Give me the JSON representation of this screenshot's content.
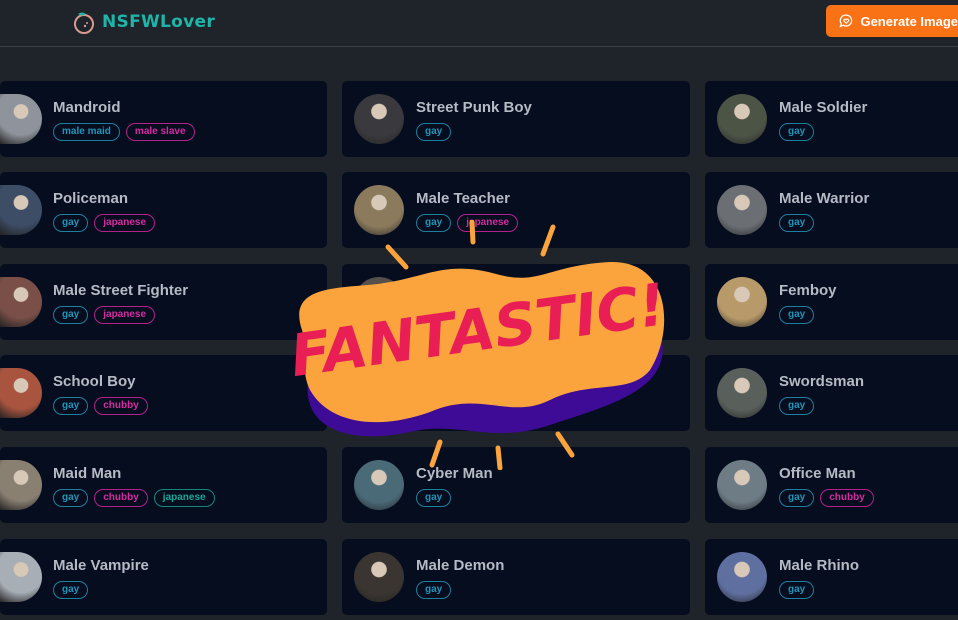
{
  "header": {
    "brand": "NSFWLover",
    "generate_button": "Generate Image"
  },
  "colors": {
    "accent": "#f97316",
    "brand": "#1fb5a8",
    "tag_blue": "#1f95b8",
    "tag_pink": "#d62ba0",
    "tag_teal": "#17a89a"
  },
  "cards": [
    {
      "name": "Mandroid",
      "tags": [
        {
          "label": "male maid",
          "color": "blue"
        },
        {
          "label": "male slave",
          "color": "pink"
        }
      ],
      "avatar": "#8f949c"
    },
    {
      "name": "Street Punk Boy",
      "tags": [
        {
          "label": "gay",
          "color": "blue"
        }
      ],
      "avatar": "#3a3a3e"
    },
    {
      "name": "Male Soldier",
      "tags": [
        {
          "label": "gay",
          "color": "blue"
        }
      ],
      "avatar": "#4c5446"
    },
    {
      "name": "Policeman",
      "tags": [
        {
          "label": "gay",
          "color": "blue"
        },
        {
          "label": "japanese",
          "color": "pink"
        }
      ],
      "avatar": "#3d4d66"
    },
    {
      "name": "Male Teacher",
      "tags": [
        {
          "label": "gay",
          "color": "blue"
        },
        {
          "label": "japanese",
          "color": "pink"
        }
      ],
      "avatar": "#8b7a5c"
    },
    {
      "name": "Male Warrior",
      "tags": [
        {
          "label": "gay",
          "color": "blue"
        }
      ],
      "avatar": "#6b6f74"
    },
    {
      "name": "Male Street Fighter",
      "tags": [
        {
          "label": "gay",
          "color": "blue"
        },
        {
          "label": "japanese",
          "color": "pink"
        }
      ],
      "avatar": "#7a4f48"
    },
    {
      "name": "",
      "tags": [],
      "avatar": "#55504c"
    },
    {
      "name": "Femboy",
      "tags": [
        {
          "label": "gay",
          "color": "blue"
        }
      ],
      "avatar": "#b89a6a"
    },
    {
      "name": "School Boy",
      "tags": [
        {
          "label": "gay",
          "color": "blue"
        },
        {
          "label": "chubby",
          "color": "pink"
        }
      ],
      "avatar": "#a9543e"
    },
    {
      "name": "",
      "tags": [],
      "avatar": "#444"
    },
    {
      "name": "Swordsman",
      "tags": [
        {
          "label": "gay",
          "color": "blue"
        }
      ],
      "avatar": "#59605c"
    },
    {
      "name": "Maid Man",
      "tags": [
        {
          "label": "gay",
          "color": "blue"
        },
        {
          "label": "chubby",
          "color": "pink"
        },
        {
          "label": "japanese",
          "color": "teal"
        }
      ],
      "avatar": "#8a8072"
    },
    {
      "name": "Cyber Man",
      "tags": [
        {
          "label": "gay",
          "color": "blue"
        }
      ],
      "avatar": "#4a6a78"
    },
    {
      "name": "Office Man",
      "tags": [
        {
          "label": "gay",
          "color": "blue"
        },
        {
          "label": "chubby",
          "color": "pink"
        }
      ],
      "avatar": "#6e7c86"
    },
    {
      "name": "Male Vampire",
      "tags": [
        {
          "label": "gay",
          "color": "blue"
        }
      ],
      "avatar": "#a8aeb6"
    },
    {
      "name": "Male Demon",
      "tags": [
        {
          "label": "gay",
          "color": "blue"
        }
      ],
      "avatar": "#3a3530"
    },
    {
      "name": "Male Rhino",
      "tags": [
        {
          "label": "gay",
          "color": "blue"
        }
      ],
      "avatar": "#5f6fa0"
    }
  ],
  "sticker": {
    "text": "FANTASTIC!",
    "fill": "#fba43e",
    "shadow": "#3e0b96",
    "text_color": "#e91e55",
    "rays": "#fba43e"
  }
}
